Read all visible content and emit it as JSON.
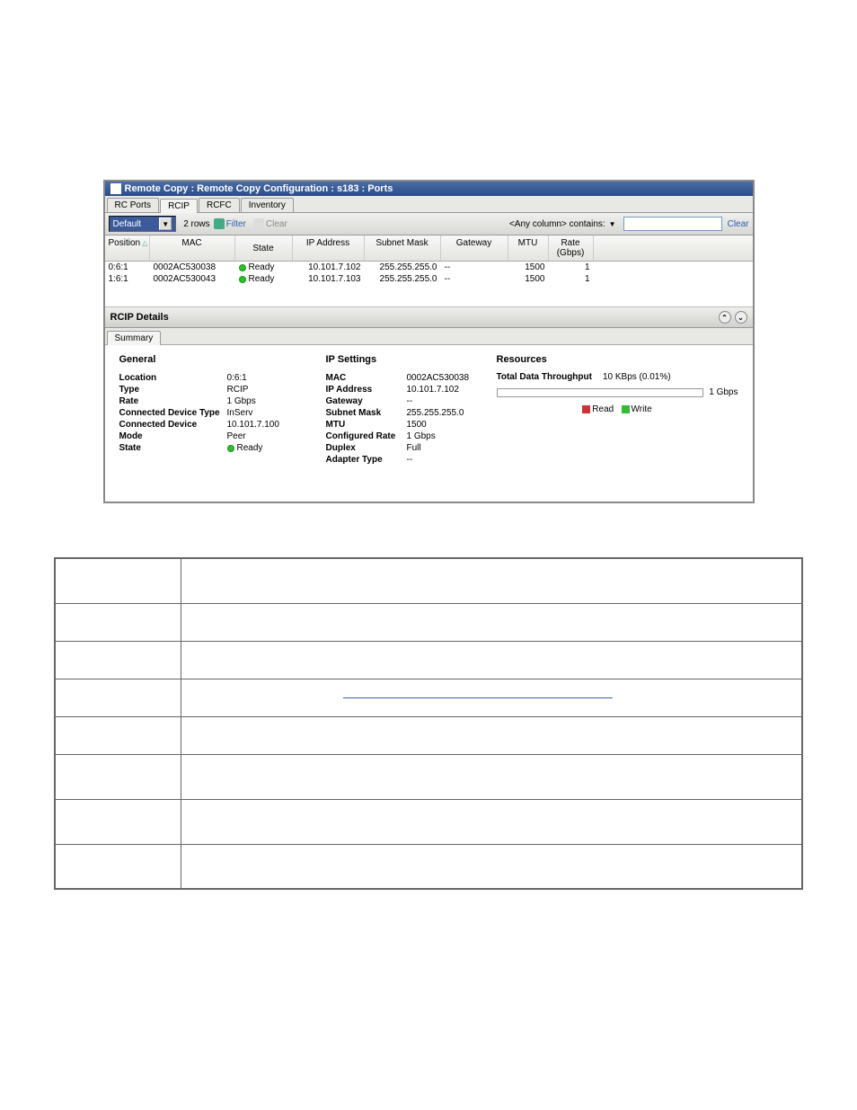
{
  "window": {
    "title": "Remote Copy : Remote Copy Configuration : s183 : Ports"
  },
  "mainTabs": [
    "RC Ports",
    "RCIP",
    "RCFC",
    "Inventory"
  ],
  "activeMainTab": 1,
  "toolbar": {
    "combo": "Default",
    "rows": "2 rows",
    "filter": "Filter",
    "clear": "Clear",
    "searchLabel": "<Any column> contains:",
    "clearRight": "Clear"
  },
  "grid": {
    "columns": [
      "Position",
      "MAC",
      "State",
      "IP Address",
      "Subnet Mask",
      "Gateway",
      "MTU",
      "Rate (Gbps)"
    ],
    "rows": [
      {
        "position": "0:6:1",
        "mac": "0002AC530038",
        "state": "Ready",
        "ip": "10.101.7.102",
        "mask": "255.255.255.0",
        "gateway": "--",
        "mtu": "1500",
        "rate": "1"
      },
      {
        "position": "1:6:1",
        "mac": "0002AC530043",
        "state": "Ready",
        "ip": "10.101.7.103",
        "mask": "255.255.255.0",
        "gateway": "--",
        "mtu": "1500",
        "rate": "1"
      }
    ]
  },
  "details": {
    "title": "RCIP Details",
    "subTab": "Summary",
    "general": {
      "heading": "General",
      "items": [
        {
          "k": "Location",
          "v": "0:6:1"
        },
        {
          "k": "Type",
          "v": "RCIP"
        },
        {
          "k": "Rate",
          "v": "1 Gbps"
        },
        {
          "k": "Connected Device Type",
          "v": "InServ"
        },
        {
          "k": "Connected Device",
          "v": "10.101.7.100"
        },
        {
          "k": "Mode",
          "v": "Peer"
        },
        {
          "k": "State",
          "v": "Ready",
          "dot": true
        }
      ]
    },
    "ip": {
      "heading": "IP Settings",
      "items": [
        {
          "k": "MAC",
          "v": "0002AC530038"
        },
        {
          "k": "IP Address",
          "v": "10.101.7.102"
        },
        {
          "k": "Gateway",
          "v": "--"
        },
        {
          "k": "Subnet Mask",
          "v": "255.255.255.0"
        },
        {
          "k": "MTU",
          "v": "1500"
        },
        {
          "k": "Configured Rate",
          "v": "1 Gbps"
        },
        {
          "k": "Duplex",
          "v": "Full"
        },
        {
          "k": "Adapter Type",
          "v": "--"
        }
      ]
    },
    "resources": {
      "heading": "Resources",
      "throughputLabel": "Total Data Throughput",
      "throughputValue": "10 KBps (0.01%)",
      "barMax": "1 Gbps",
      "legendRead": "Read",
      "legendWrite": "Write"
    }
  }
}
